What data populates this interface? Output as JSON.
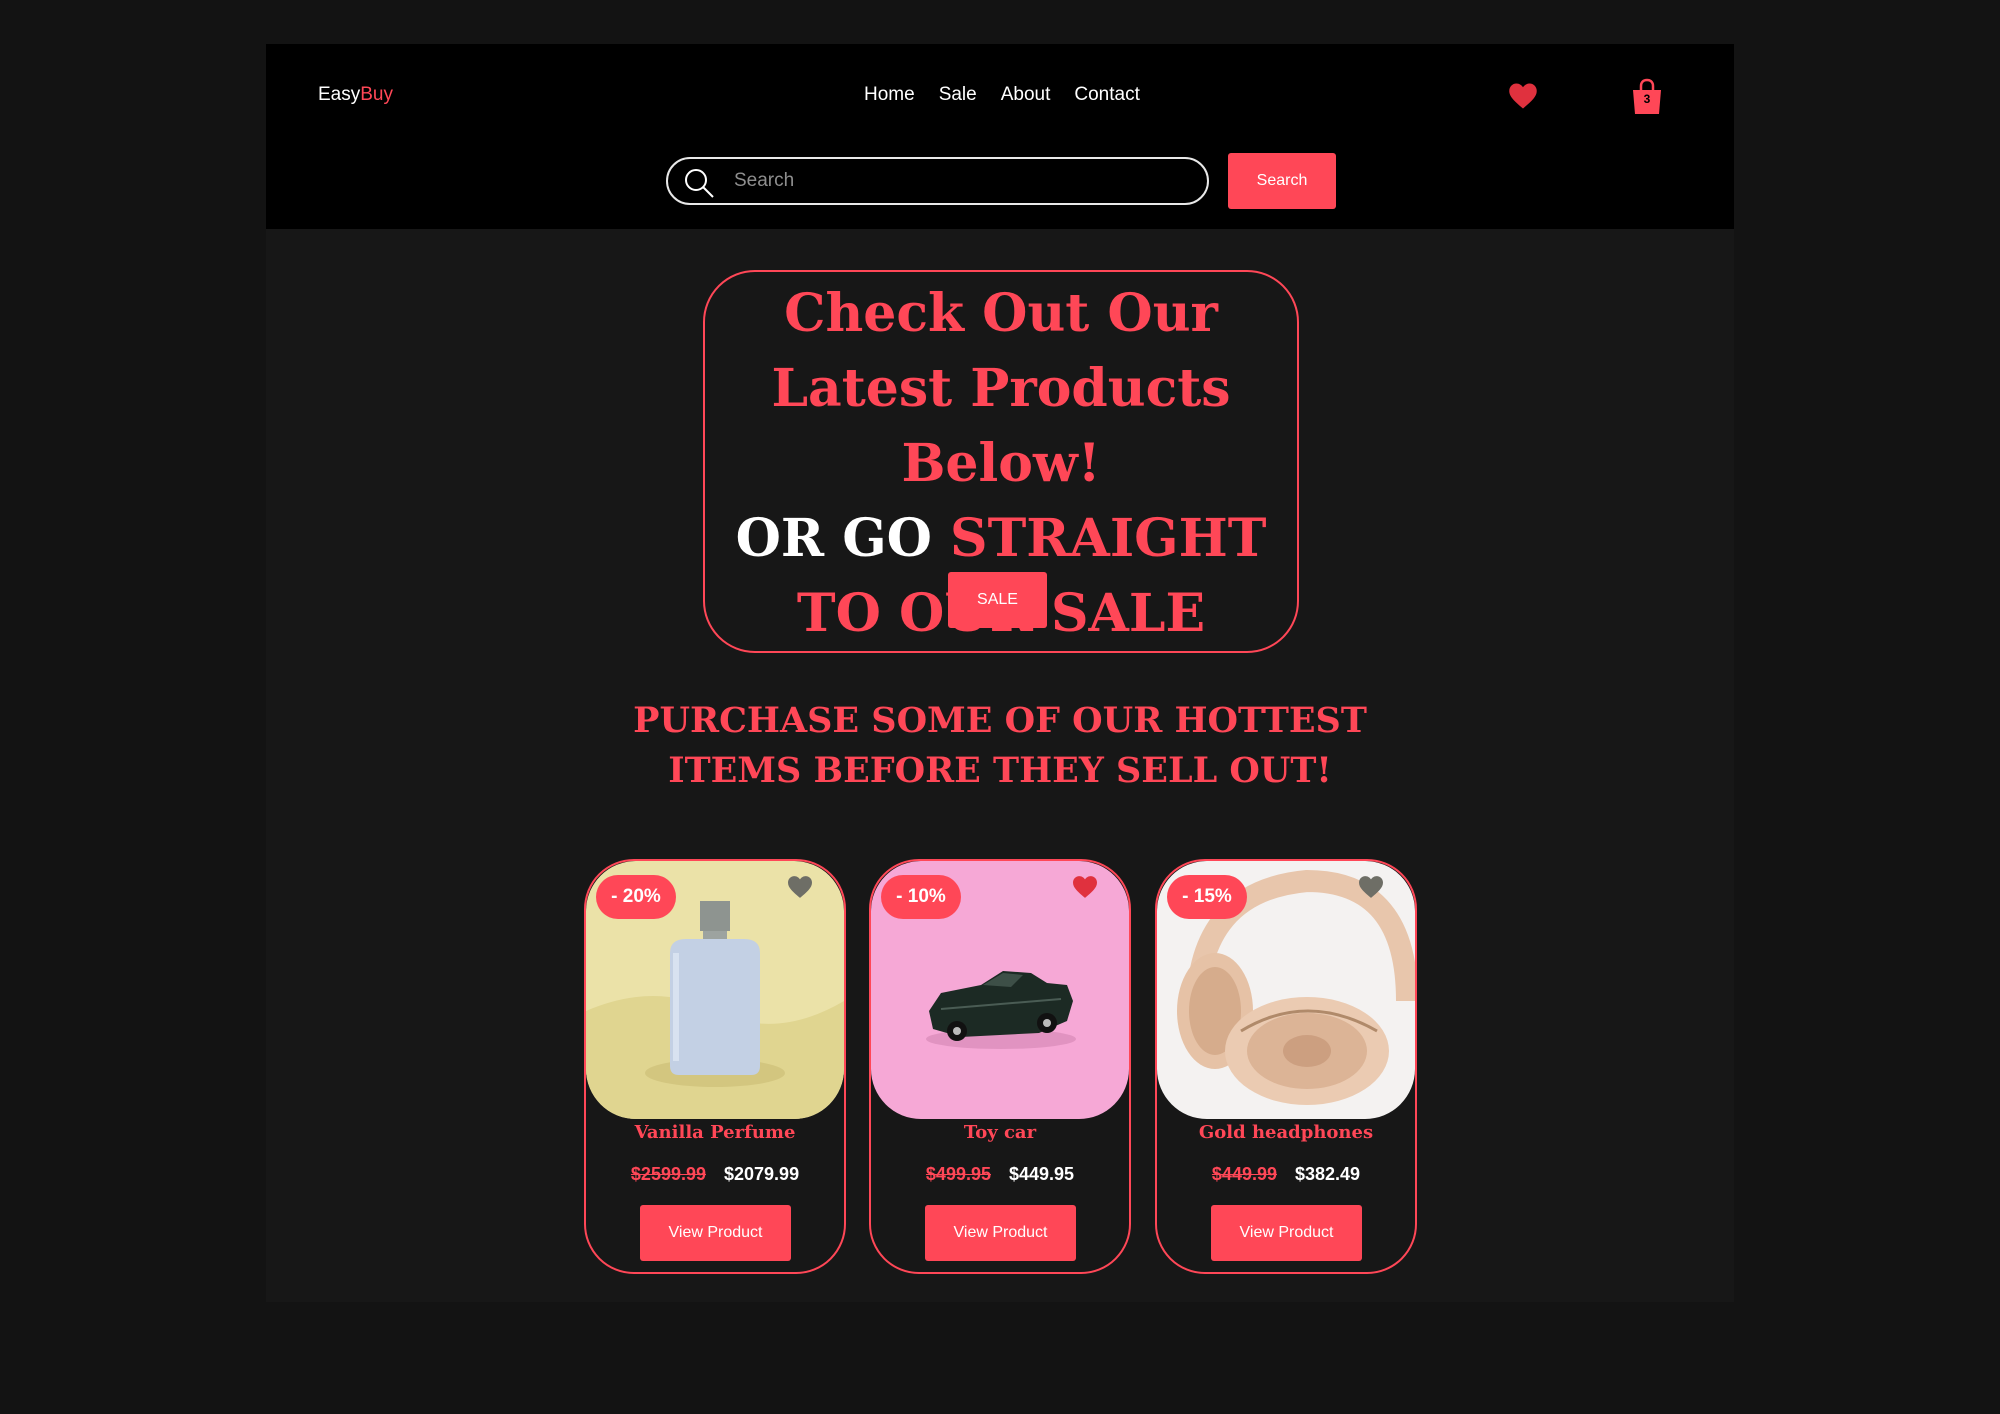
{
  "header": {
    "logo_easy": "Easy",
    "logo_buy": "Buy",
    "nav": [
      "Home",
      "Sale",
      "About",
      "Contact"
    ],
    "cart_count": "3",
    "search_placeholder": "Search",
    "search_button": "Search"
  },
  "hero": {
    "title": "Check Out Our Latest Products Below!",
    "subtitle_white": "OR GO ",
    "subtitle_red": "STRAIGHT TO OUR SALE",
    "sale_button": "SALE"
  },
  "hot_heading": "PURCHASE SOME OF OUR HOTTEST ITEMS BEFORE THEY SELL OUT!",
  "products": [
    {
      "name": "Vanilla Perfume",
      "discount": "- 20%",
      "old_price": "$2599.99",
      "new_price": "$2079.99",
      "button": "View Product",
      "favorited": false
    },
    {
      "name": "Toy car",
      "discount": "- 10%",
      "old_price": "$499.95",
      "new_price": "$449.95",
      "button": "View Product",
      "favorited": true
    },
    {
      "name": "Gold headphones",
      "discount": "- 15%",
      "old_price": "$449.99",
      "new_price": "$382.49",
      "button": "View Product",
      "favorited": false
    }
  ],
  "colors": {
    "accent": "#ff4757",
    "background": "#131313",
    "header": "#000000",
    "fav_active": "#e0313e",
    "fav_inactive": "#6e6e66"
  }
}
